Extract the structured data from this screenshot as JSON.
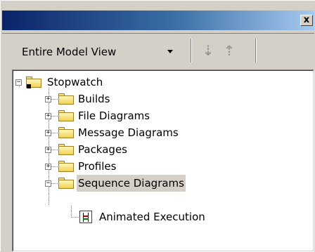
{
  "window": {
    "close_glyph": "x"
  },
  "toolbar": {
    "view_selector": "Entire Model View",
    "move_down_icon": "arrow-down-icon",
    "move_up_icon": "arrow-up-icon"
  },
  "tree": {
    "root": {
      "label": "Stopwatch",
      "state": "expanded"
    },
    "children": [
      {
        "label": "Builds",
        "state": "collapsed"
      },
      {
        "label": "File Diagrams",
        "state": "collapsed"
      },
      {
        "label": "Message Diagrams",
        "state": "collapsed"
      },
      {
        "label": "Packages",
        "state": "collapsed"
      },
      {
        "label": "Profiles",
        "state": "collapsed"
      },
      {
        "label": "Sequence Diagrams",
        "state": "expanded",
        "selected": true
      }
    ],
    "leaf": {
      "label": "Animated Execution"
    }
  }
}
